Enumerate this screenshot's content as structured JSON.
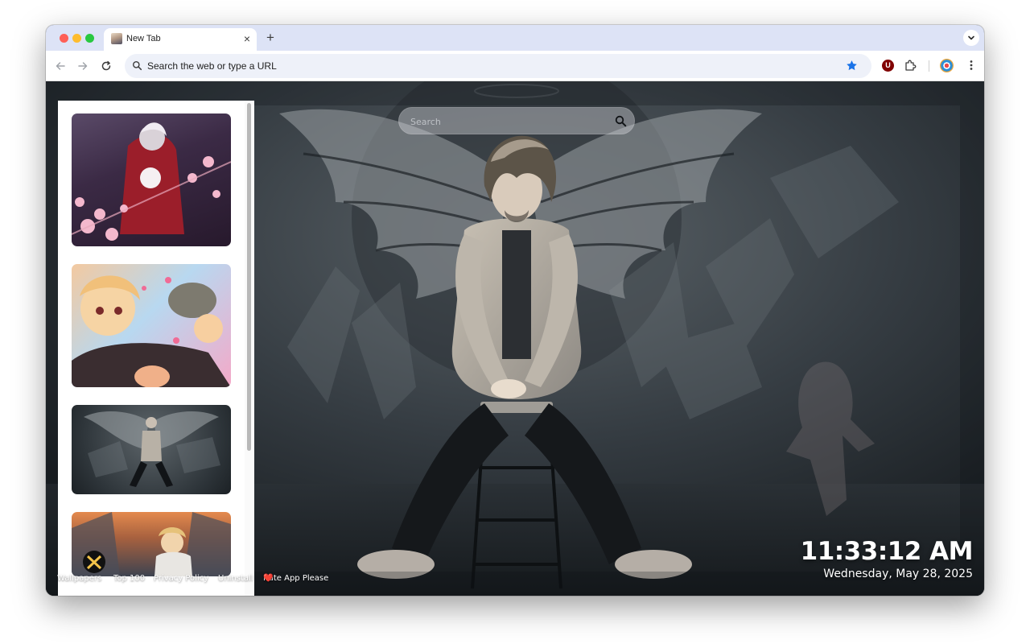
{
  "browser": {
    "tab": {
      "title": "New Tab",
      "favicon": "anime-portrait-favicon",
      "close_glyph": "×"
    },
    "new_tab_glyph": "+",
    "omnibox": {
      "placeholder": "Search the web or type a URL"
    },
    "extensions": [
      {
        "name": "ublock-origin",
        "glyph": "U",
        "color": "#800000"
      },
      {
        "name": "extensions-puzzle"
      }
    ],
    "accent": "#1a73e8"
  },
  "newtab": {
    "search": {
      "placeholder": "Search"
    },
    "sidebar": {
      "thumbnails": [
        {
          "name": "red-jacket-sakura"
        },
        {
          "name": "colorful-cartoon-group"
        },
        {
          "name": "winged-figure-dark"
        },
        {
          "name": "city-sunset-character"
        }
      ]
    },
    "footer_links": {
      "wallpapers": "Wallpapers",
      "top100": "Top 100",
      "privacy": "Privacy Policy",
      "uninstall": "Uninstall",
      "rate_heart": "❤️",
      "rate": "Rate App Please"
    },
    "clock": {
      "time": "11:33:12 AM",
      "date": "Wednesday, May 28, 2025"
    }
  }
}
